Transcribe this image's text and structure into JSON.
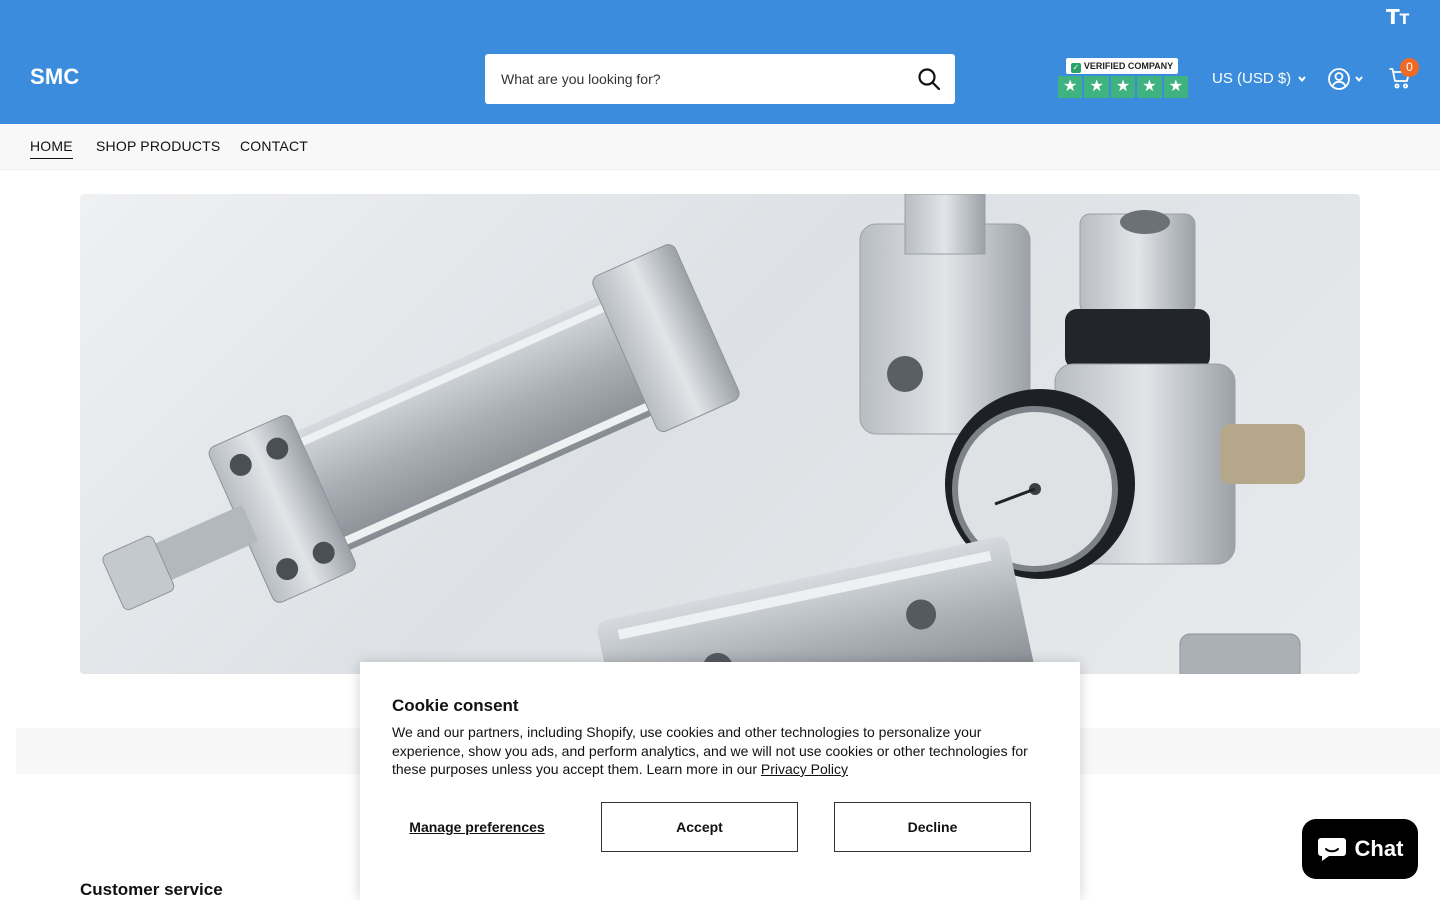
{
  "header": {
    "logo": "SMC",
    "text_size_icon": "text-size-icon",
    "search": {
      "placeholder": "What are you looking for?",
      "icon": "search-icon"
    },
    "trust_badge": {
      "label": "VERIFIED COMPANY",
      "stars": [
        "★",
        "★",
        "★",
        "★",
        "★"
      ]
    },
    "currency": "US (USD $)",
    "account_icon": "user-circle-icon",
    "cart": {
      "icon": "cart-icon",
      "count": "0"
    },
    "colors": {
      "bar": "#3b8cdc",
      "badge": "#f06a23",
      "trust": "#3fb37f"
    }
  },
  "nav": {
    "items": [
      {
        "label": "HOME",
        "active": true
      },
      {
        "label": "SHOP PRODUCTS",
        "active": false
      },
      {
        "label": "CONTACT",
        "active": false
      }
    ]
  },
  "footer": {
    "heading": "Customer service"
  },
  "cookie": {
    "title": "Cookie consent",
    "body": "We and our partners, including Shopify, use cookies and other technologies to personalize your experience, show you ads, and perform analytics, and we will not use cookies or other technologies for these purposes unless you accept them. Learn more in our ",
    "link": "Privacy Policy",
    "manage": "Manage preferences",
    "accept": "Accept",
    "decline": "Decline"
  },
  "chat": {
    "label": "Chat",
    "icon": "chat-bubble-icon"
  }
}
